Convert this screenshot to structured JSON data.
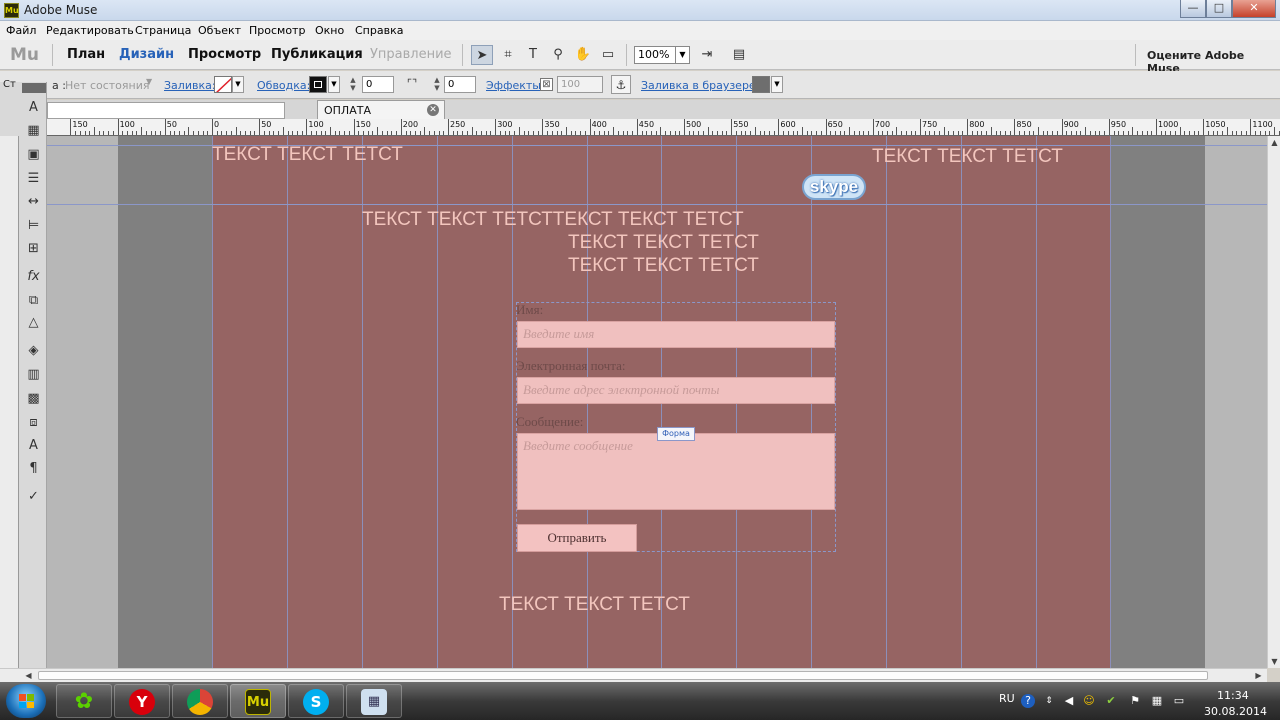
{
  "window": {
    "title": "Adobe Muse",
    "app_icon": "Mu",
    "minimize": "—",
    "maximize": "□",
    "close": "✕"
  },
  "menu": [
    "Файл",
    "Редактировать",
    "Страница",
    "Объект",
    "Просмотр",
    "Окно",
    "Справка"
  ],
  "toolbar": {
    "logo": "Mu",
    "modes": [
      "План",
      "Дизайн",
      "Просмотр",
      "Публикация",
      "Управление"
    ],
    "active_mode": "Дизайн",
    "zoom": "100%",
    "rate": "Оцените Adobe Muse"
  },
  "controlbar": {
    "state_label": "Ст",
    "state_colon": "а :",
    "state_value": "Нет состояния",
    "fill_label": "Заливка:",
    "stroke_label": "Обводка:",
    "stroke_width": "0",
    "corner_value": "0",
    "effects_label": "Эффекты:",
    "effects_value": "100",
    "browser_fill_label": "Заливка в браузере:"
  },
  "tabs": {
    "document_tab": "ОПЛАТА",
    "close": "✕"
  },
  "ruler": {
    "labels": [
      "150",
      "100",
      "50",
      "0",
      "50",
      "100",
      "150",
      "200",
      "250",
      "300",
      "350",
      "400",
      "450",
      "500",
      "550",
      "600",
      "650",
      "700",
      "750",
      "800",
      "850",
      "900",
      "950",
      "1000",
      "1050",
      "1100"
    ]
  },
  "canvas": {
    "header_texts": [
      "ТЕКСТ ТЕКСТ ТЕТСТ",
      "ТЕКСТ ТЕКСТ ТЕТСТ",
      "ТЕКСТ ТЕКСТ ТЕТСТТЕКСТ ТЕКСТ ТЕТСТ",
      "ТЕКСТ ТЕКСТ ТЕТСТ",
      "ТЕКСТ ТЕКСТ ТЕТСТ"
    ],
    "footer_text": "ТЕКСТ ТЕКСТ ТЕТСТ",
    "skype_logo": "skype",
    "form": {
      "name_label": "Имя:",
      "name_placeholder": "Введите имя",
      "email_label": "Электронная почта:",
      "email_placeholder": "Введите адрес электронной почты",
      "message_label": "Сообщение:",
      "message_placeholder": "Введите сообщение",
      "tag": "Форма",
      "submit": "Отправить"
    },
    "colors": {
      "content": "#966463",
      "page": "#808080",
      "outside": "#b7b7b7",
      "text": "#f3c6be",
      "guides": "#8b97c9"
    }
  },
  "taskbar": {
    "apps": [
      "icq-icon",
      "yandex-browser-icon",
      "chrome-icon",
      "adobe-muse-icon",
      "skype-icon",
      "calculator-icon"
    ],
    "muse_glyph": "Mu",
    "yandex_glyph": "Y",
    "skype_glyph": "S",
    "lang": "RU",
    "time": "11:34",
    "date": "30.08.2014"
  }
}
